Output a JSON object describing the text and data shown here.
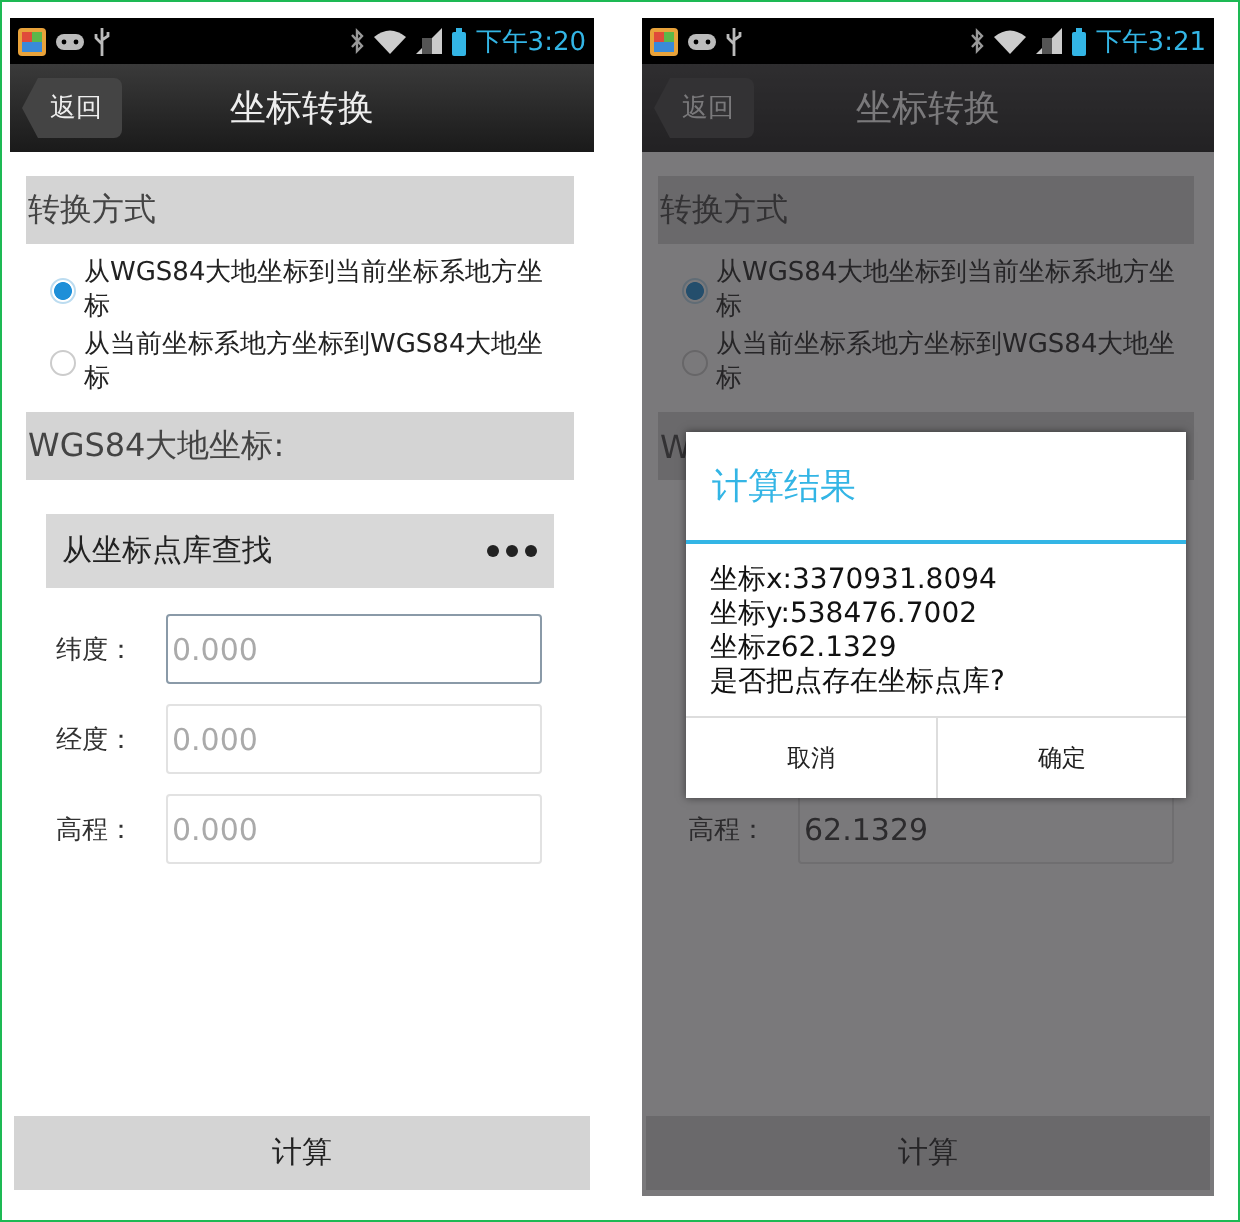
{
  "screens": [
    {
      "status_bar": {
        "time": "下午3:20"
      },
      "back_button": "返回",
      "title": "坐标转换",
      "conversion_section": "转换方式",
      "options": [
        {
          "label": "从WGS84大地坐标到当前坐标系地方坐标",
          "selected": true
        },
        {
          "label": "从当前坐标系地方坐标到WGS84大地坐标",
          "selected": false
        }
      ],
      "coordinate_section": "WGS84大地坐标:",
      "lookup": {
        "label": "从坐标点库查找"
      },
      "fields": [
        {
          "label": "纬度：",
          "placeholder": "0.000",
          "focused": true
        },
        {
          "label": "经度：",
          "placeholder": "0.000",
          "focused": false
        },
        {
          "label": "高程：",
          "placeholder": "0.000",
          "focused": false
        }
      ],
      "calculate_button": "计算"
    },
    {
      "status_bar": {
        "time": "下午3:21"
      },
      "back_button": "返回",
      "title": "坐标转换",
      "conversion_section": "转换方式",
      "options": [
        {
          "label": "从WGS84大地坐标到当前坐标系地方坐标",
          "selected": true
        },
        {
          "label": "从当前坐标系地方坐标到WGS84大地坐标",
          "selected": false
        }
      ],
      "coordinate_section": "W",
      "fields": [
        {
          "label": "高程：",
          "value": "62.1329",
          "focused": false
        }
      ],
      "calculate_button": "计算",
      "dialog": {
        "title": "计算结果",
        "lines": [
          "坐标x:3370931.8094",
          "坐标y:538476.7002",
          "坐标z62.1329",
          "是否把点存在坐标点库?"
        ],
        "buttons": [
          "取消",
          "确定"
        ]
      }
    }
  ]
}
